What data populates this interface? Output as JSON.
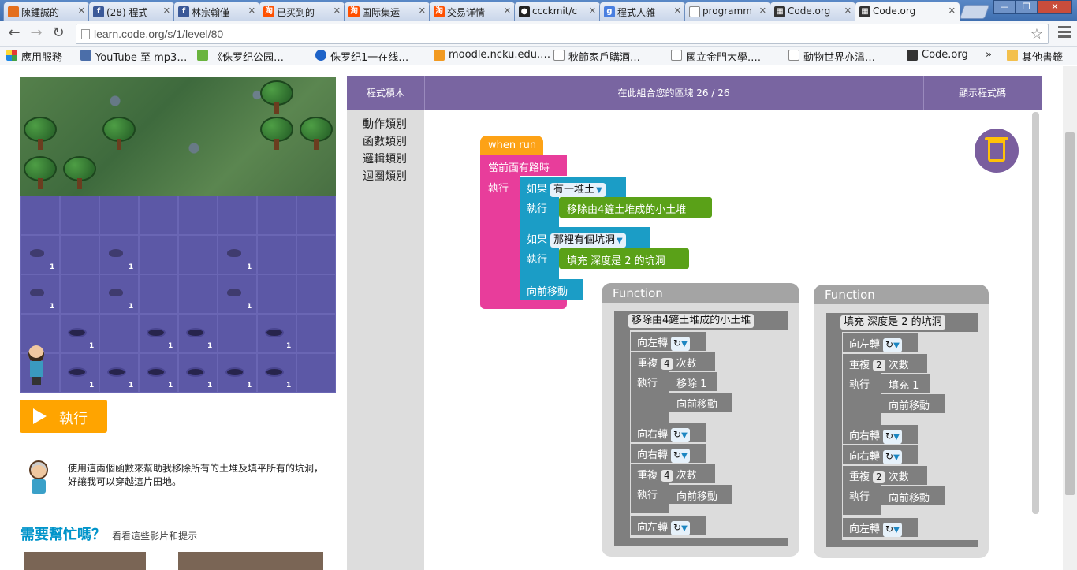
{
  "browser": {
    "tabs": [
      {
        "label": "陳鍾誠的",
        "icon_color": "#e46f1d",
        "icon": "doc-icon"
      },
      {
        "label": "(28) 程式",
        "icon_color": "#3b5998",
        "icon": "facebook-icon"
      },
      {
        "label": "林宗翰僅",
        "icon_color": "#3b5998",
        "icon": "facebook-icon"
      },
      {
        "label": "已买到的",
        "icon_color": "#ff5000",
        "icon": "taobao-icon"
      },
      {
        "label": "国际集运",
        "icon_color": "#ff5000",
        "icon": "taobao-icon"
      },
      {
        "label": "交易详情",
        "icon_color": "#ff5000",
        "icon": "taobao-icon"
      },
      {
        "label": "ccckmit/c",
        "icon_color": "#222222",
        "icon": "github-icon"
      },
      {
        "label": "程式人雜",
        "icon_color": "#4a7fe0",
        "icon": "google-icon"
      },
      {
        "label": "programm",
        "icon_color": "#ffffff",
        "icon": "page-icon"
      },
      {
        "label": "Code.org",
        "icon_color": "#333333",
        "icon": "codeorg-icon"
      },
      {
        "label": "Code.org",
        "icon_color": "#333333",
        "icon": "codeorg-icon"
      }
    ],
    "url": "learn.code.org/s/1/level/80",
    "bookmarks": [
      {
        "label": "應用服務",
        "icon": "apps-icon"
      },
      {
        "label": "YouTube 至 mp3…",
        "icon": "youtube-mp3-icon"
      },
      {
        "label": "《侏罗纪公园…",
        "icon": "iqiyi-icon"
      },
      {
        "label": "侏罗纪1一在线…",
        "icon": "play-icon"
      },
      {
        "label": "moodle.ncku.edu.…",
        "icon": "moodle-icon"
      },
      {
        "label": "秋節家戶購酒…",
        "icon": "page-icon"
      },
      {
        "label": "國立金門大學.…",
        "icon": "page-icon"
      },
      {
        "label": "動物世界亦溫…",
        "icon": "page-icon"
      },
      {
        "label": "Code.org",
        "icon": "codeorg-icon"
      },
      {
        "label": "其他書籤",
        "icon": "folder-icon"
      }
    ],
    "overflow_label": "»"
  },
  "left": {
    "run_label": "執行",
    "instructions": "使用這兩個函數來幫助我移除所有的土堆及填平所有的坑洞，好讓我可以穿越這片田地。",
    "help_title": "需要幫忙嗎？",
    "help_sub": "看看這些影片和提示"
  },
  "maze": {
    "mound_count_label": "1",
    "colors": {
      "grass": "#4f7a45",
      "ground": "#5e5aa8"
    }
  },
  "workspace": {
    "toolbox_label": "程式積木",
    "header_center": "在此組合您的區塊 26 / 26",
    "show_code": "顯示程式碼",
    "categories": [
      "動作類別",
      "函數類別",
      "邏輯類別",
      "迴圈類別"
    ]
  },
  "blocks": {
    "when_run": "when run",
    "while_path": "當前面有路時",
    "do": "執行",
    "if": "如果",
    "pile_option": "有一堆土",
    "hole_option": "那裡有個坑洞",
    "call_remove": "移除由4鏟土堆成的小土堆",
    "call_fill": "填充  深度是 2 的坑洞",
    "move_forward": "向前移動"
  },
  "functions": [
    {
      "title": "Function",
      "name": "移除由4鏟土堆成的小土堆",
      "turn_left": "向左轉",
      "turn_right": "向右轉",
      "repeat": "重複",
      "times": "次數",
      "do": "執行",
      "count1": "4",
      "count2": "4",
      "action": "移除 1",
      "move": "向前移動",
      "rot_symbol": "↻",
      "arrow": "▼"
    },
    {
      "title": "Function",
      "name": "填充  深度是 2 的坑洞",
      "turn_left": "向左轉",
      "turn_right": "向右轉",
      "repeat": "重複",
      "times": "次數",
      "do": "執行",
      "count1": "2",
      "count2": "2",
      "action": "填充 1",
      "move": "向前移動",
      "rot_symbol": "↻",
      "arrow": "▼"
    }
  ]
}
